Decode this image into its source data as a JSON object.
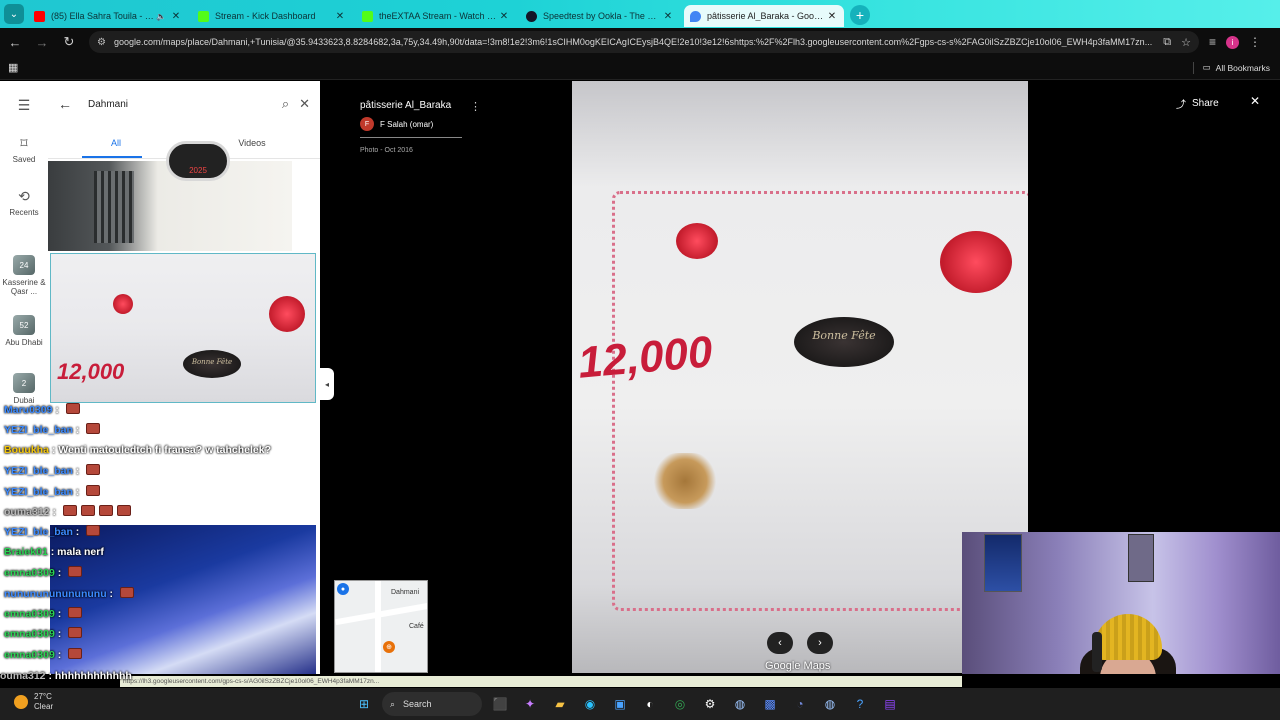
{
  "browser": {
    "tabs": [
      {
        "title": "(85) Ella Sahra Touila - You",
        "color": "#ff0000"
      },
      {
        "title": "Stream - Kick Dashboard",
        "color": "#53fc18"
      },
      {
        "title": "theEXTAA Stream - Watch Live",
        "color": "#53fc18"
      },
      {
        "title": "Speedtest by Ookla - The Glob",
        "color": "#141526"
      },
      {
        "title": "pâtisserie Al_Baraka - Google M",
        "color": "#4285f4"
      }
    ],
    "url": "google.com/maps/place/Dahmani,+Tunisia/@35.9433623,8.8284682,3a,75y,34.49h,90t/data=!3m8!1e2!3m6!1sCIHM0ogKEICAgICEysjB4QE!2e10!3e12!6shttps:%2F%2Flh3.googleusercontent.com%2Fgps-cs-s%2FAG0ilSzZBZCje10ol06_EWH4p3faMM17zn...",
    "bookmarks_label": "All Bookmarks"
  },
  "maps": {
    "rail": {
      "saved": "Saved",
      "recents": "Recents",
      "recent1": "Kasserine & Qasr ...",
      "recent2": "Abu Dhabi",
      "recent3": "Dubai"
    },
    "search_query": "Dahmani",
    "tabs": {
      "all": "All",
      "videos": "Videos"
    },
    "photo_thumb": {
      "price": "12,000",
      "plaque": "Bonne Fête"
    },
    "minimap_label": "Dahmani",
    "minimap_cafe": "Café"
  },
  "viewer": {
    "place_title": "pâtisserie Al_Baraka",
    "author": "F Salah (omar)",
    "author_initial": "F",
    "date": "Photo - Oct 2016",
    "share_label": "Share",
    "price": "12,000",
    "plaque": "Bonne Fête",
    "watermark": "Google Maps"
  },
  "chat": {
    "messages": [
      {
        "user": "Maru0309",
        "text": "",
        "color": "#3b8aff",
        "emotes": 1
      },
      {
        "user": "YEZI_ble_ban",
        "text": "",
        "color": "#3b8aff",
        "emotes": 1
      },
      {
        "user": "Bouukha",
        "text": "Wenti matouledtch fi fransa? w tahchelek?",
        "color": "#f2c50b",
        "emotes": 0
      },
      {
        "user": "YEZI_ble_ban",
        "text": "",
        "color": "#3b8aff",
        "emotes": 1
      },
      {
        "user": "YEZI_ble_ban",
        "text": "",
        "color": "#3b8aff",
        "emotes": 1
      },
      {
        "user": "ouma312",
        "text": "",
        "color": "#b9b9b9",
        "emotes": 4
      },
      {
        "user": "YEZI_ble_ban",
        "text": "",
        "color": "#3b8aff",
        "emotes": 1
      },
      {
        "user": "Braiek01",
        "text": "mala nerf",
        "color": "#2ad354",
        "emotes": 0
      },
      {
        "user": "emna0309",
        "text": "",
        "color": "#2ad354",
        "emotes": 1
      },
      {
        "user": "nunununununununu",
        "text": "",
        "color": "#3b8aff",
        "emotes": 1
      },
      {
        "user": "emna0309",
        "text": "",
        "color": "#2ad354",
        "emotes": 1
      },
      {
        "user": "emna0309",
        "text": "",
        "color": "#2ad354",
        "emotes": 1
      },
      {
        "user": "emna0309",
        "text": "",
        "color": "#2ad354",
        "emotes": 1
      }
    ],
    "bottom_user": "ouma312",
    "bottom_text": "hhhhhhhhhhhh"
  },
  "status_url": "https://lh3.googleusercontent.com/gps-cs-s/AG0ilSzZBZCje10ol06_EWH4p3faMM17zn...",
  "taskbar": {
    "temp": "27°C",
    "weather": "Clear",
    "search": "Search"
  }
}
